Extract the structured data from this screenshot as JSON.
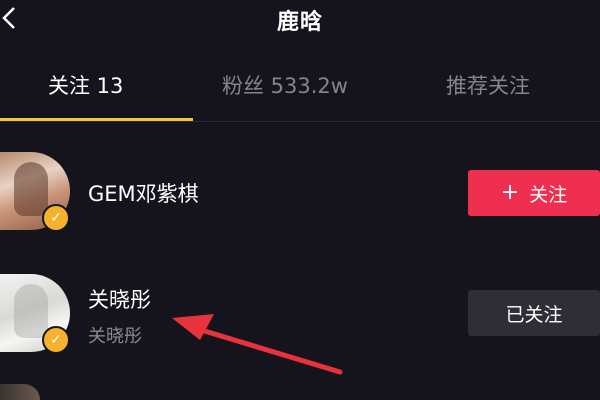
{
  "header": {
    "title": "鹿晗",
    "back_icon": "chevron-left-icon"
  },
  "tabs": [
    {
      "label": "关注 13",
      "active": true
    },
    {
      "label": "粉丝 533.2w",
      "active": false
    },
    {
      "label": "推荐关注",
      "active": false
    }
  ],
  "users": [
    {
      "name": "GEM邓紫棋",
      "subtitle": "",
      "verified": true,
      "button_label": "关注",
      "button_icon": "plus-icon",
      "button_color": "#ee2f4f"
    },
    {
      "name": "关晓彤",
      "subtitle": "关晓彤",
      "verified": true,
      "button_label": "已关注",
      "button_color": "#2f2e37"
    }
  ],
  "colors": {
    "background": "#15141d",
    "tab_indicator": "#f5c242",
    "verified_badge": "#f5b22d",
    "annotation_arrow": "#e8323c"
  }
}
